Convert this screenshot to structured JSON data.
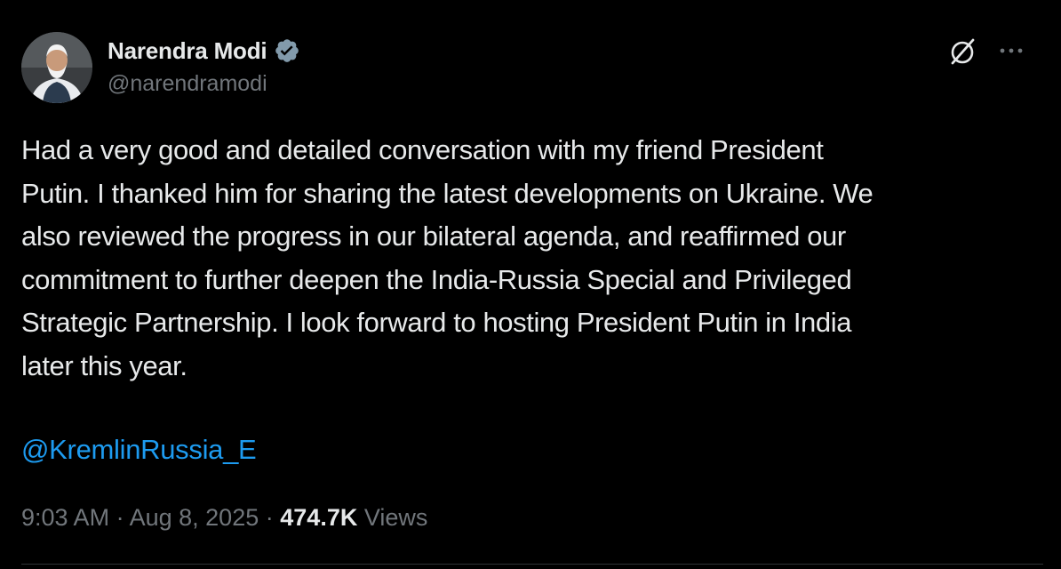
{
  "author": {
    "name": "Narendra Modi",
    "handle": "@narendramodi",
    "verified": true,
    "avatar_icon": "avatar-photo"
  },
  "actions": {
    "grok_icon": "grok-icon",
    "more_icon": "more-horizontal-icon"
  },
  "tweet": {
    "lines": [
      "Had a very good and detailed conversation with my friend President",
      "Putin. I thanked him for sharing the latest developments on Ukraine. We",
      "also reviewed the progress in our bilateral agenda, and reaffirmed our",
      "commitment to further deepen the India-Russia Special and Privileged",
      "Strategic Partnership. I look forward to hosting President Putin in India",
      "later this year."
    ],
    "mention": "@KremlinRussia_E"
  },
  "meta": {
    "time": "9:03 AM",
    "separator": "·",
    "date": "Aug 8, 2025",
    "views_count": "474.7K",
    "views_label": "Views"
  },
  "colors": {
    "background": "#000000",
    "text": "#e7e9ea",
    "secondary": "#71767b",
    "link": "#1d9bf0",
    "verified": "#1d9bf0"
  }
}
